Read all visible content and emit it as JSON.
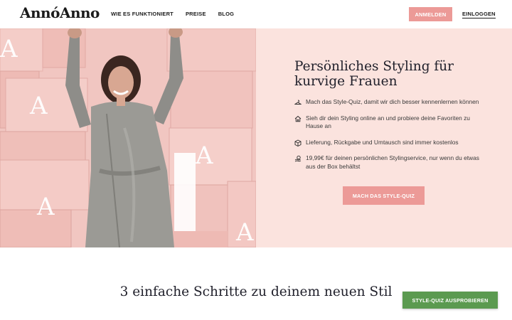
{
  "header": {
    "logo": "AnnóAnno",
    "nav": [
      {
        "label": "WIE ES FUNKTIONIERT"
      },
      {
        "label": "PREISE"
      },
      {
        "label": "BLOG"
      }
    ],
    "login_button": "ANMELDEN",
    "signin_link": "EINLOGGEN"
  },
  "hero": {
    "title_line1": "Persönliches Styling für",
    "title_line2": "kurvige Frauen",
    "features": [
      {
        "icon": "hanger-icon",
        "text": "Mach das Style-Quiz, damit wir dich besser kennenlernen können"
      },
      {
        "icon": "home-icon",
        "text": "Sieh dir dein Styling online an und probiere deine Favoriten zu Hause an"
      },
      {
        "icon": "box-icon",
        "text": "Lieferung, Rückgabe und Umtausch sind immer kostenlos"
      },
      {
        "icon": "coins-icon",
        "text": "19,99€  für deinen persönlichen Stylingservice, nur wenn du etwas aus der Box behältst"
      }
    ],
    "cta": "MACH DAS STYLE-QUIZ",
    "image_box_letters": "A"
  },
  "steps": {
    "title": "3 einfache Schritte zu deinem neuen Stil"
  },
  "sticky_cta": "STYLE-QUIZ AUSPROBIEREN",
  "colors": {
    "accent": "#ec9a97",
    "hero_bg": "#fbe3de",
    "cta_green": "#5b9a50",
    "text_dark": "#1f1f2a"
  }
}
